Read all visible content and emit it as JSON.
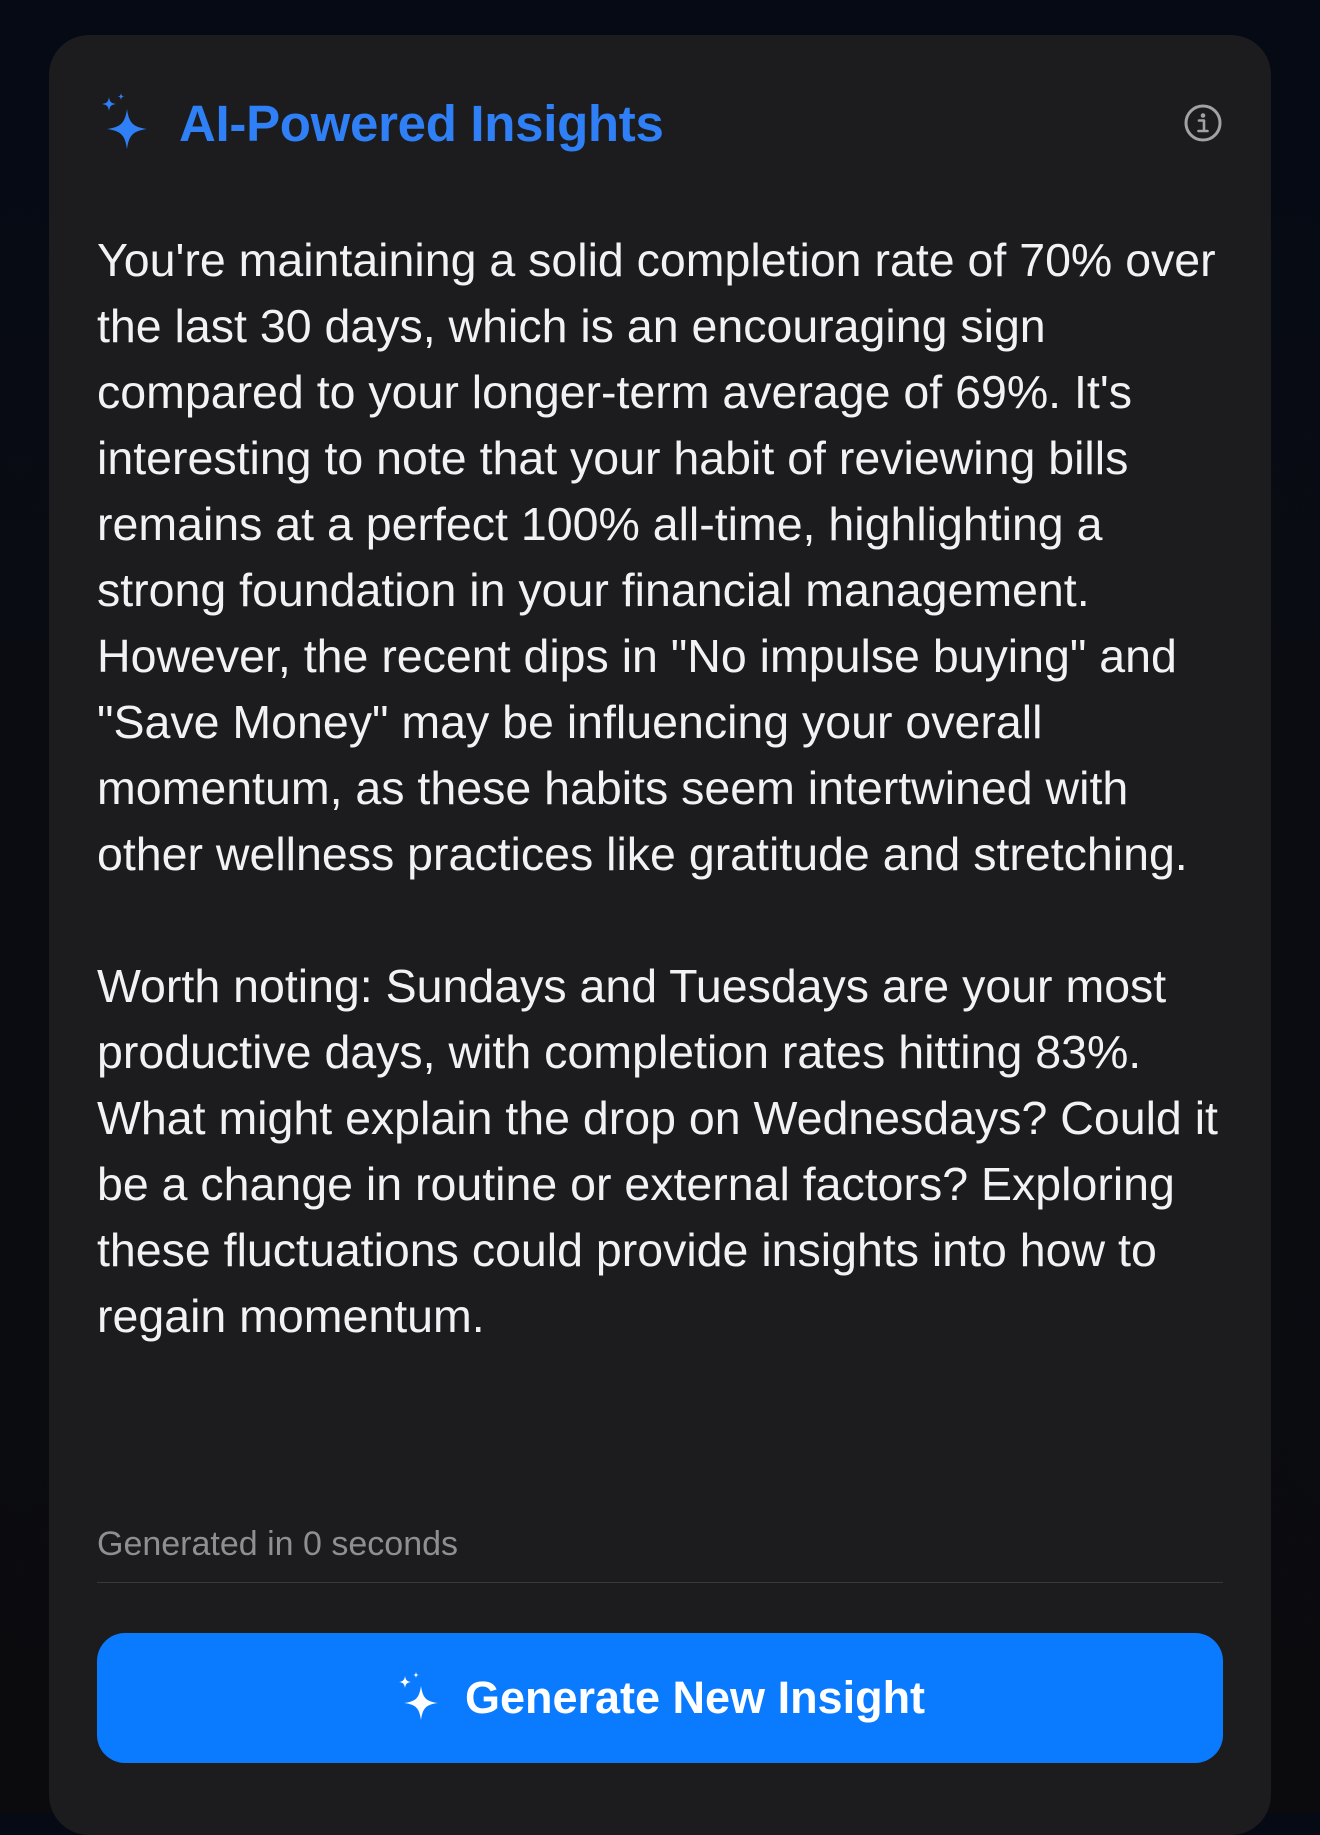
{
  "card": {
    "title": "AI-Powered Insights",
    "title_icon": "sparkles-icon",
    "info_icon": "info-circle-icon",
    "paragraphs": [
      "You're maintaining a solid completion rate of 70% over the last 30 days, which is an encouraging sign compared to your longer-term average of 69%. It's interesting to note that your habit of reviewing bills remains at a perfect 100% all-time, highlighting a strong foundation in your financial management. However, the recent dips in \"No impulse buying\" and \"Save Money\" may be influencing your overall momentum, as these habits seem intertwined with other wellness practices like gratitude and stretching.",
      "Worth noting: Sundays and Tuesdays are your most productive days, with completion rates hitting 83%. What might explain the drop on Wednesdays? Could it be a change in routine or external factors? Exploring these fluctuations could provide insights into how to regain momentum."
    ],
    "generated_text": "Generated in 0 seconds",
    "button": {
      "label": "Generate New Insight",
      "icon": "sparkles-icon"
    }
  },
  "colors": {
    "accent": "#0a7aff",
    "title": "#2f80f6",
    "card_bg": "#1c1c1e",
    "text": "#f2f2f4",
    "muted": "#8e8e93"
  }
}
